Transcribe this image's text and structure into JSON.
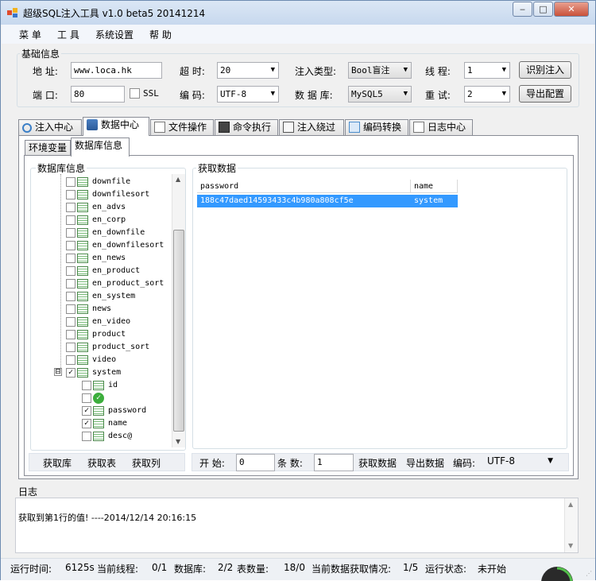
{
  "window": {
    "title": "超级SQL注入工具 v1.0 beta5 20141214",
    "min": "‒",
    "max": "□",
    "close": "✕"
  },
  "menu": [
    "菜 单",
    "工 具",
    "系统设置",
    "帮 助"
  ],
  "basic": {
    "group_label": "基础信息",
    "address_label": "地 址:",
    "address_value": "www.loca.hk",
    "timeout_label": "超 时:",
    "timeout_value": "20",
    "inject_type_label": "注入类型:",
    "inject_type_value": "Bool盲注",
    "threads_label": "线 程:",
    "threads_value": "1",
    "identify_button": "识别注入",
    "port_label": "端 口:",
    "port_value": "80",
    "ssl_label": "SSL",
    "encoding_label": "编 码:",
    "encoding_value": "UTF-8",
    "db_label": "数 据 库:",
    "db_value": "MySQL5",
    "retry_label": "重 试:",
    "retry_value": "2",
    "export_button": "导出配置"
  },
  "tabs": [
    "注入中心",
    "数据中心",
    "文件操作",
    "命令执行",
    "注入绕过",
    "编码转换",
    "日志中心"
  ],
  "subtabs": [
    "环境变量",
    "数据库信息"
  ],
  "dbinfo": {
    "label": "数据库信息",
    "tables": [
      "downfile",
      "downfilesort",
      "en_advs",
      "en_corp",
      "en_downfile",
      "en_downfilesort",
      "en_news",
      "en_product",
      "en_product_sort",
      "en_system",
      "news",
      "en_video",
      "product",
      "product_sort",
      "video",
      "system"
    ],
    "expand_glyph": "⊟",
    "check_glyph": "✓",
    "columns": [
      "id",
      "",
      "password",
      "name",
      "desc@"
    ]
  },
  "fetch": {
    "label": "获取数据",
    "headers": [
      "password",
      "name"
    ],
    "rows": [
      [
        "188c47daed14593433c4b980a808cf5e",
        "system"
      ]
    ]
  },
  "left_toolbar": [
    "获取库",
    "获取表",
    "获取列"
  ],
  "right_toolbar": {
    "start_label": "开 始:",
    "start_value": "0",
    "count_label": "条 数:",
    "count_value": "1",
    "fetch_button": "获取数据",
    "export_button": "导出数据",
    "encoding_label": "编码:",
    "encoding_value": "UTF-8"
  },
  "log": {
    "label": "日志",
    "text": "获取到第1行的值! ----2014/12/14 20:16:15"
  },
  "status": {
    "runtime_label": "运行时间:",
    "runtime_value": "6125s",
    "thread_label": "当前线程:",
    "thread_value": "0/1",
    "db_label": "数据库:",
    "db_value": "2/2",
    "tables_label": "表数量:",
    "tables_value": "18/0",
    "fetch_label": "当前数据获取情况:",
    "fetch_value": "1/5",
    "state_label": "运行状态:",
    "state_value": "未开始"
  },
  "colors": {
    "selection": "#3399ff",
    "title_bar": "#c7d8ee"
  }
}
